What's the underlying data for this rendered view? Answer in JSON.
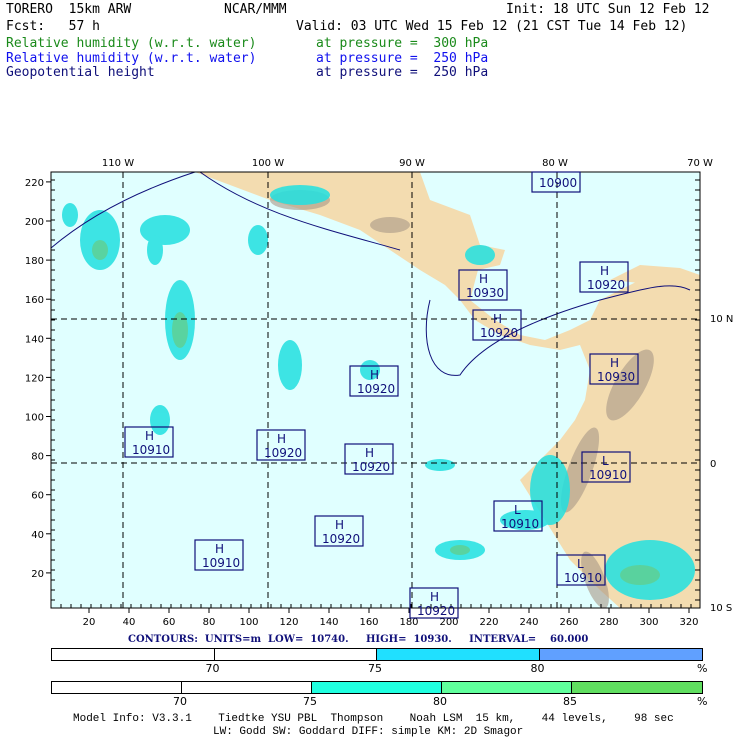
{
  "header": {
    "model": "TORERO  15km ARW",
    "center": "NCAR/MMM",
    "init": "Init: 18 UTC Sun 12 Feb 12",
    "fcst": "Fcst:   57 h",
    "valid": "Valid: 03 UTC Wed 15 Feb 12 (21 CST Tue 14 Feb 12)",
    "fields": [
      {
        "name": "Relative humidity (w.r.t. water)",
        "level": "at pressure =  300 hPa",
        "color": "#1a8a1a"
      },
      {
        "name": "Relative humidity (w.r.t. water)",
        "level": "at pressure =  250 hPa",
        "color": "#1010ee"
      },
      {
        "name": "Geopotential height",
        "level": "at pressure =  250 hPa",
        "color": "#10107a"
      }
    ]
  },
  "map": {
    "top_labels": [
      "110 W",
      "100 W",
      "90 W",
      "80 W",
      "70 W"
    ],
    "right_labels": [
      "10 N",
      "0",
      "10 S"
    ],
    "left_ticks": [
      "220",
      "200",
      "180",
      "160",
      "140",
      "120",
      "100",
      "80",
      "60",
      "40",
      "20"
    ],
    "bottom_ticks": [
      "20",
      "40",
      "60",
      "80",
      "100",
      "120",
      "140",
      "160",
      "180",
      "200",
      "220",
      "240",
      "260",
      "280",
      "300",
      "320"
    ],
    "centers": [
      {
        "type": "H",
        "value": "10900"
      },
      {
        "type": "H",
        "value": "10930"
      },
      {
        "type": "H",
        "value": "10920"
      },
      {
        "type": "H",
        "value": "10920"
      },
      {
        "type": "H",
        "value": "10930"
      },
      {
        "type": "H",
        "value": "10920"
      },
      {
        "type": "H",
        "value": "10910"
      },
      {
        "type": "H",
        "value": "10920"
      },
      {
        "type": "H",
        "value": "10920"
      },
      {
        "type": "L",
        "value": "10910"
      },
      {
        "type": "L",
        "value": "10910"
      },
      {
        "type": "H",
        "value": "10920"
      },
      {
        "type": "H",
        "value": "10910"
      },
      {
        "type": "L",
        "value": "10910"
      },
      {
        "type": "H",
        "value": "10920"
      }
    ]
  },
  "contours": "CONTOURS:  UNITS=m  LOW=  10740.     HIGH=  10930.     INTERVAL=    60.000",
  "legend1": {
    "colors": [
      "#ffffff",
      "#ffffff",
      "#20e0ff",
      "#60a0ff"
    ],
    "labels": [
      "70",
      "75",
      "80"
    ],
    "unit": "%"
  },
  "legend2": {
    "colors": [
      "#ffffff",
      "#ffffff",
      "#20ffe0",
      "#60ff9c",
      "#60de60"
    ],
    "labels": [
      "70",
      "75",
      "80",
      "85"
    ],
    "unit": "%"
  },
  "footer": {
    "line1": "Model Info: V3.3.1    Tiedtke YSU PBL  Thompson    Noah LSM  15 km,    44 levels,    98 sec",
    "line2": "LW: Godd SW: Goddard DIFF: simple KM: 2D Smagor"
  }
}
